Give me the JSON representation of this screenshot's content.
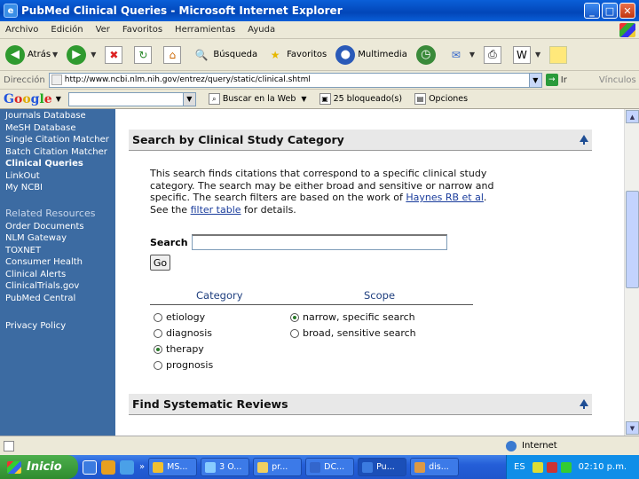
{
  "window": {
    "title": "PubMed Clinical Queries - Microsoft Internet Explorer"
  },
  "menu": [
    "Archivo",
    "Edición",
    "Ver",
    "Favoritos",
    "Herramientas",
    "Ayuda"
  ],
  "toolbar": {
    "back": "Atrás",
    "search": "Búsqueda",
    "favorites": "Favoritos",
    "media": "Multimedia"
  },
  "address": {
    "label": "Dirección",
    "url": "http://www.ncbi.nlm.nih.gov/entrez/query/static/clinical.shtml",
    "go": "Ir",
    "links": "Vínculos"
  },
  "google": {
    "search_web": "Buscar en la Web",
    "blocked": "25 bloqueado(s)",
    "options": "Opciones"
  },
  "sidebar": {
    "items_top": [
      "Journals Database",
      "MeSH Database",
      "Single Citation Matcher",
      "Batch Citation Matcher",
      "Clinical Queries",
      "LinkOut",
      "My NCBI"
    ],
    "related_title": "Related Resources",
    "items_related": [
      "Order Documents",
      "NLM Gateway",
      "TOXNET",
      "Consumer Health",
      "Clinical Alerts",
      "ClinicalTrials.gov",
      "PubMed Central"
    ],
    "privacy": "Privacy Policy"
  },
  "main": {
    "section1_title": "Search by Clinical Study Category",
    "description": "This search finds citations that correspond to a specific clinical study category. The search may be either broad and sensitive or narrow and specific. The search filters are based on the work of",
    "link_haynes": "Haynes RB et al",
    "see_the": ". See the",
    "link_filter": "filter table",
    "for_details": "for details.",
    "search_label": "Search",
    "go_button": "Go",
    "category_label": "Category",
    "scope_label": "Scope",
    "categories": [
      "etiology",
      "diagnosis",
      "therapy",
      "prognosis"
    ],
    "scopes": [
      "narrow, specific search",
      "broad, sensitive search"
    ],
    "section2_title": "Find Systematic Reviews"
  },
  "status": {
    "zone": "Internet"
  },
  "taskbar": {
    "start": "Inicio",
    "tasks": [
      "MS...",
      "3 O...",
      "pr...",
      "DC...",
      "Pu...",
      "dis..."
    ],
    "lang": "ES",
    "clock": "02:10 p.m."
  },
  "colors": {
    "sidebar_bg": "#3c6ba2",
    "link": "#1a3c9c",
    "header_bg": "#e8e8e8"
  }
}
